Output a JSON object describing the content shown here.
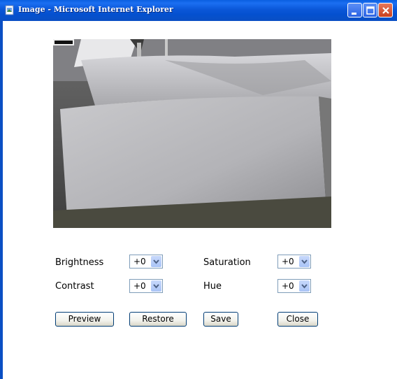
{
  "window": {
    "title": "Image - Microsoft Internet Explorer"
  },
  "settings": {
    "brightness": {
      "label": "Brightness",
      "value": "+0"
    },
    "saturation": {
      "label": "Saturation",
      "value": "+0"
    },
    "contrast": {
      "label": "Contrast",
      "value": "+0"
    },
    "hue": {
      "label": "Hue",
      "value": "+0"
    }
  },
  "buttons": {
    "preview": "Preview",
    "restore": "Restore",
    "save": "Save",
    "close": "Close"
  },
  "icons": {
    "app": "ie-page-icon",
    "minimize": "minimize-icon",
    "maximize": "maximize-icon",
    "close": "close-icon",
    "dropdown": "chevron-down-icon"
  },
  "colors": {
    "titlebar": "#0a4fc4",
    "close_button": "#c9401f",
    "select_border": "#7f9db9"
  }
}
